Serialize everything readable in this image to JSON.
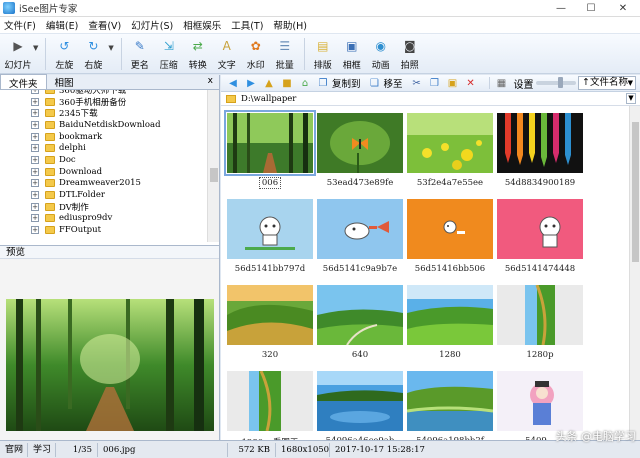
{
  "window": {
    "title": "iSee图片专家",
    "min": "—",
    "max": "☐",
    "close": "✕"
  },
  "menu": [
    "文件(F)",
    "编辑(E)",
    "查看(V)",
    "幻灯片(S)",
    "相框娱乐",
    "工具(T)",
    "帮助(H)"
  ],
  "toolbar": [
    {
      "label": "幻灯片",
      "icon": "slideshow-icon",
      "color": "#555555"
    },
    {
      "label": "左旋",
      "icon": "rotate-left-icon",
      "color": "#2f8fe0"
    },
    {
      "label": "右旋",
      "icon": "rotate-right-icon",
      "color": "#2f8fe0"
    },
    {
      "label": "更名",
      "icon": "rename-icon",
      "color": "#3a7bc8"
    },
    {
      "label": "压缩",
      "icon": "compress-icon",
      "color": "#2e9fcf"
    },
    {
      "label": "转换",
      "icon": "convert-icon",
      "color": "#4caa4c"
    },
    {
      "label": "文字",
      "icon": "text-icon",
      "color": "#c8a23a"
    },
    {
      "label": "水印",
      "icon": "watermark-icon",
      "color": "#e07a1f"
    },
    {
      "label": "批量",
      "icon": "batch-icon",
      "color": "#6b8fb8"
    },
    {
      "label": "排版",
      "icon": "layout-icon",
      "color": "#d9b23a"
    },
    {
      "label": "相框",
      "icon": "frame-icon",
      "color": "#3b6fb5"
    },
    {
      "label": "动画",
      "icon": "animation-icon",
      "color": "#2e8fd0"
    },
    {
      "label": "拍照",
      "icon": "camera-icon",
      "color": "#444444"
    }
  ],
  "left_tabs": {
    "tab1": "文件夹",
    "tab2": "相图",
    "close": "x"
  },
  "tree_items": [
    "360驱动大师下载",
    "360手机相册备份",
    "2345下载",
    "BaiduNetdiskDownload",
    "bookmark",
    "delphi",
    "Doc",
    "Download",
    "Dreamweaver2015",
    "DTLFolder",
    "DV制作",
    "ediuspro9dv",
    "FFOutput"
  ],
  "preview_label": "预览",
  "right_toolbar": {
    "copy_to": "复制到",
    "move_to": "移至",
    "settings": "设置",
    "sort": "↑文件名称"
  },
  "path": "D:\\wallpaper",
  "thumbnails": [
    {
      "caption": "006",
      "kind": "forest",
      "selected": true
    },
    {
      "caption": "53ead473e89fe",
      "kind": "butterfly"
    },
    {
      "caption": "53f2e4a7e55ee",
      "kind": "canola"
    },
    {
      "caption": "54d8834900189",
      "kind": "pencils"
    },
    {
      "caption": "56d5141bb797d",
      "kind": "cat-blue"
    },
    {
      "caption": "56d5141c9a9b7e",
      "kind": "cat-fish"
    },
    {
      "caption": "56d51416bb506",
      "kind": "cat-orange"
    },
    {
      "caption": "56d5141474448",
      "kind": "cat-pink"
    },
    {
      "caption": "320",
      "kind": "hills-sunset"
    },
    {
      "caption": "640",
      "kind": "valley"
    },
    {
      "caption": "1280",
      "kind": "meadow"
    },
    {
      "caption": "1280p",
      "kind": "meadow-narrow"
    },
    {
      "caption": "1280p_看图王",
      "kind": "meadow-narrow2"
    },
    {
      "caption": "54096a46ce9ab",
      "kind": "lake"
    },
    {
      "caption": "54096a198bb2f",
      "kind": "green-lake"
    },
    {
      "caption": "5409...",
      "kind": "cartoon"
    }
  ],
  "status": {
    "tab1": "官网",
    "tab2": "学习",
    "index": "1/35",
    "filename": "006.jpg",
    "size": "572 KB",
    "dimensions": "1680x1050",
    "datetime": "2017-10-17 15:28:17"
  },
  "watermark": "头条 @电脑学习"
}
